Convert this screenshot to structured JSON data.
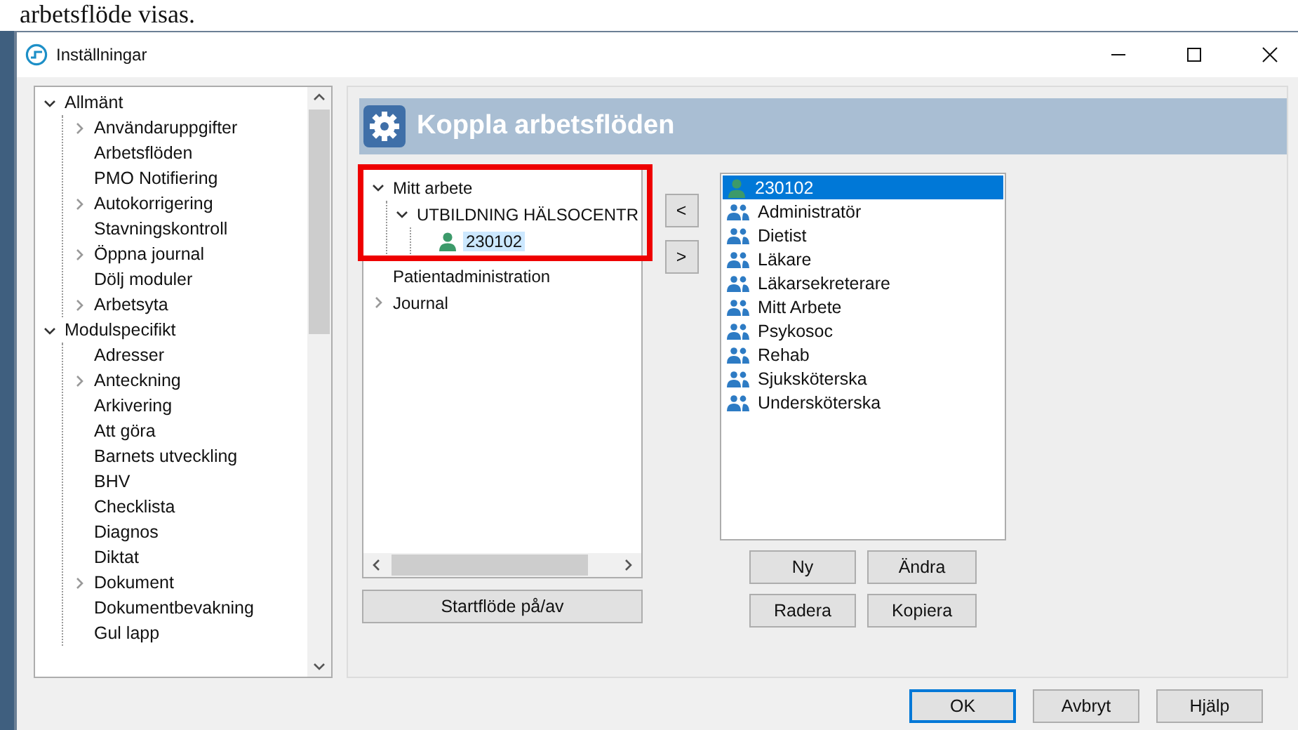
{
  "document_text": "arbetsflöde visas.",
  "window": {
    "title": "Inställningar"
  },
  "settings_tree": [
    {
      "label": "Allmänt",
      "kind": "branch",
      "expanded": true,
      "children": [
        {
          "label": "Användaruppgifter",
          "kind": "branch",
          "expanded": false
        },
        {
          "label": "Arbetsflöden",
          "kind": "leaf"
        },
        {
          "label": "PMO Notifiering",
          "kind": "leaf"
        },
        {
          "label": "Autokorrigering",
          "kind": "branch",
          "expanded": false
        },
        {
          "label": "Stavningskontroll",
          "kind": "leaf"
        },
        {
          "label": "Öppna journal",
          "kind": "branch",
          "expanded": false
        },
        {
          "label": "Dölj moduler",
          "kind": "leaf"
        },
        {
          "label": "Arbetsyta",
          "kind": "branch",
          "expanded": false
        }
      ]
    },
    {
      "label": "Modulspecifikt",
      "kind": "branch",
      "expanded": true,
      "children": [
        {
          "label": "Adresser",
          "kind": "leaf"
        },
        {
          "label": "Anteckning",
          "kind": "branch",
          "expanded": false
        },
        {
          "label": "Arkivering",
          "kind": "leaf"
        },
        {
          "label": "Att göra",
          "kind": "leaf"
        },
        {
          "label": "Barnets utveckling",
          "kind": "leaf"
        },
        {
          "label": "BHV",
          "kind": "leaf"
        },
        {
          "label": "Checklista",
          "kind": "leaf"
        },
        {
          "label": "Diagnos",
          "kind": "leaf"
        },
        {
          "label": "Diktat",
          "kind": "leaf"
        },
        {
          "label": "Dokument",
          "kind": "branch",
          "expanded": false
        },
        {
          "label": "Dokumentbevakning",
          "kind": "leaf"
        },
        {
          "label": "Gul lapp",
          "kind": "leaf"
        }
      ]
    }
  ],
  "panel": {
    "title": "Koppla arbetsflöden"
  },
  "workflow_tree": [
    {
      "label": "Mitt arbete",
      "kind": "branch",
      "expanded": true,
      "children": [
        {
          "label": "UTBILDNING HÄLSOCENTR",
          "kind": "branch",
          "expanded": true,
          "children": [
            {
              "label": "230102",
              "kind": "user",
              "selected": true
            }
          ]
        }
      ]
    },
    {
      "label": "Patientadministration",
      "kind": "leaf"
    },
    {
      "label": "Journal",
      "kind": "branch",
      "expanded": false
    }
  ],
  "move_buttons": [
    "<",
    ">"
  ],
  "start_button": "Startflöde på/av",
  "roles": [
    {
      "label": "230102",
      "kind": "user",
      "selected": true
    },
    {
      "label": "Administratör",
      "kind": "group",
      "selected": false
    },
    {
      "label": "Dietist",
      "kind": "group",
      "selected": false
    },
    {
      "label": "Läkare",
      "kind": "group",
      "selected": false
    },
    {
      "label": "Läkarsekreterare",
      "kind": "group",
      "selected": false
    },
    {
      "label": "Mitt Arbete",
      "kind": "group",
      "selected": false
    },
    {
      "label": "Psykosoc",
      "kind": "group",
      "selected": false
    },
    {
      "label": "Rehab",
      "kind": "group",
      "selected": false
    },
    {
      "label": "Sjuksköterska",
      "kind": "group",
      "selected": false
    },
    {
      "label": "Undersköterska",
      "kind": "group",
      "selected": false
    }
  ],
  "role_buttons": [
    "Ny",
    "Ändra",
    "Radera",
    "Kopiera"
  ],
  "dialog_buttons": [
    {
      "label": "OK",
      "default": true
    },
    {
      "label": "Avbryt",
      "default": false
    },
    {
      "label": "Hjälp",
      "default": false
    }
  ]
}
